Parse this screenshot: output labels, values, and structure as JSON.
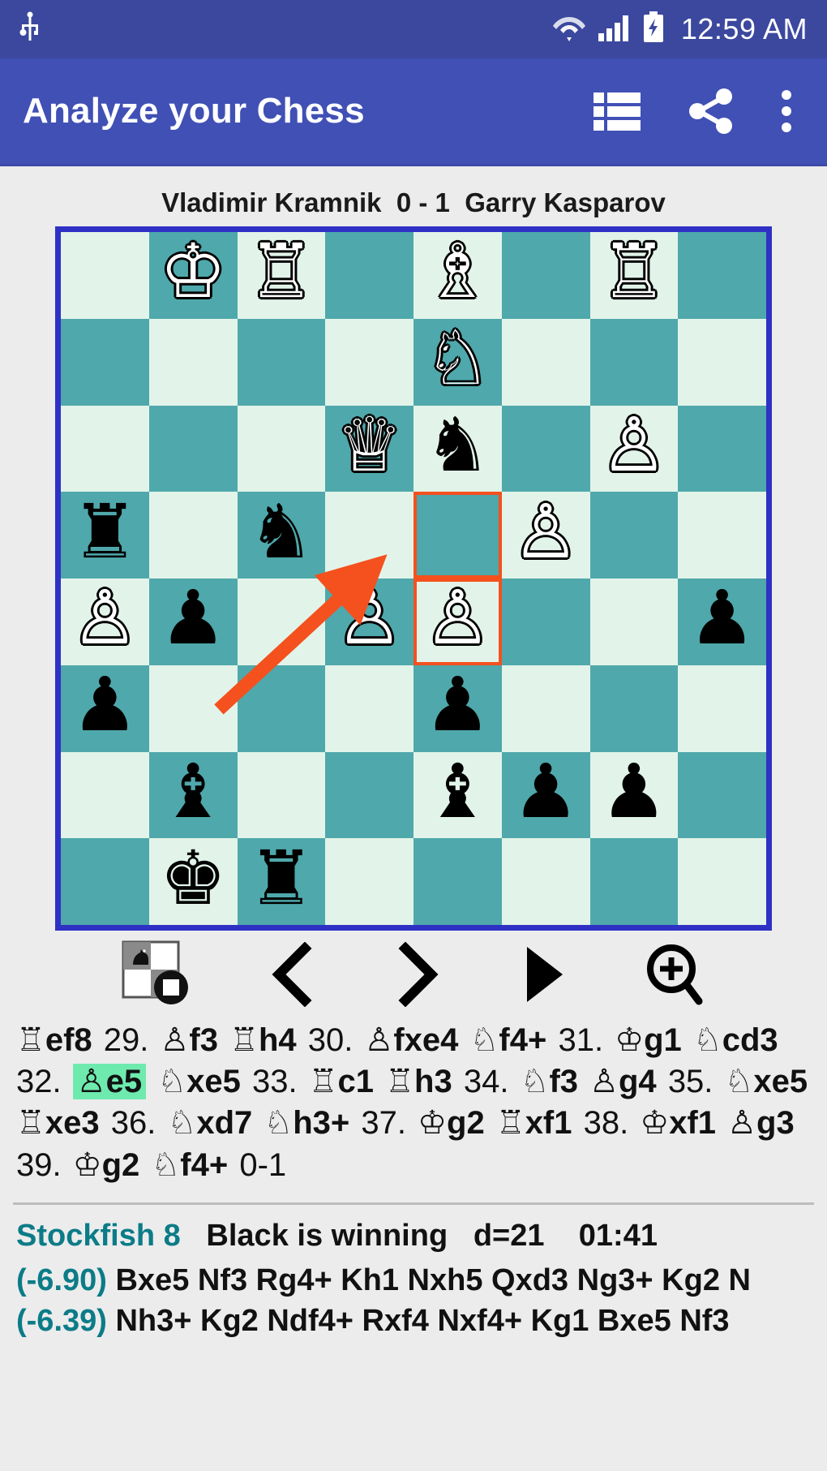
{
  "status_bar": {
    "usb_icon": "usb-icon",
    "wifi_icon": "wifi-icon",
    "signal_icon": "cellular-signal-icon",
    "battery_icon": "battery-charging-icon",
    "time": "12:59 AM"
  },
  "app_bar": {
    "title": "Analyze your Chess",
    "list_icon": "list-view-icon",
    "share_icon": "share-icon",
    "overflow_icon": "overflow-menu-icon",
    "background": "#4050b5"
  },
  "game": {
    "white_player": "Vladimir Kramnik",
    "result": "0 - 1",
    "black_player": "Garry Kasparov",
    "title_line": "Vladimir Kramnik  0 - 1  Garry Kasparov"
  },
  "board": {
    "light_square_color": "#e2f4e9",
    "dark_square_color": "#4fa8ab",
    "border_color": "#2f31c5",
    "highlight_color": "#f4511e",
    "arrow_color": "#f4511e",
    "orientation": "black-at-top-right",
    "highlighted_squares": [
      "e5",
      "e4"
    ],
    "arrow": {
      "from": "b2",
      "to": "e4"
    },
    "rows": [
      [
        null,
        "wK",
        "wR",
        null,
        "wB",
        null,
        "wR",
        null
      ],
      [
        null,
        null,
        null,
        null,
        "wN",
        null,
        null,
        null
      ],
      [
        null,
        null,
        null,
        "wQ",
        "bN",
        null,
        "wP",
        null
      ],
      [
        "bR",
        null,
        "bN",
        null,
        null,
        "wP",
        null,
        null
      ],
      [
        "wP",
        "bP",
        null,
        "wP",
        "wP",
        null,
        null,
        "bP"
      ],
      [
        "bP",
        null,
        null,
        null,
        "bP",
        null,
        null,
        null
      ],
      [
        null,
        "bB",
        null,
        null,
        "bB",
        "bP",
        "bP",
        null
      ],
      [
        null,
        "bK",
        "bR",
        null,
        null,
        null,
        null,
        null
      ]
    ]
  },
  "nav_toolbar": {
    "flip_board_icon": "flip-board-icon",
    "previous_icon": "previous-move-icon",
    "next_icon": "next-move-icon",
    "play_icon": "play-icon",
    "analyze_icon": "zoom-in-magnifier-icon"
  },
  "move_list": {
    "highlight_color": "#6eeaae",
    "current_move": "e5",
    "tokens": [
      {
        "type": "move",
        "piece": "R",
        "text": "ef8"
      },
      {
        "type": "number",
        "text": "29."
      },
      {
        "type": "move",
        "piece": "P",
        "text": "f3"
      },
      {
        "type": "move",
        "piece": "R",
        "text": "h4"
      },
      {
        "type": "number",
        "text": "30."
      },
      {
        "type": "move",
        "piece": "P",
        "text": "fxe4"
      },
      {
        "type": "move",
        "piece": "N",
        "text": "f4+"
      },
      {
        "type": "number",
        "text": "31."
      },
      {
        "type": "move",
        "piece": "K",
        "text": "g1"
      },
      {
        "type": "move",
        "piece": "N",
        "text": "cd3"
      },
      {
        "type": "number",
        "text": "32."
      },
      {
        "type": "move",
        "piece": "P",
        "text": "e5",
        "current": true
      },
      {
        "type": "move",
        "piece": "N",
        "text": "xe5"
      },
      {
        "type": "number",
        "text": "33."
      },
      {
        "type": "move",
        "piece": "R",
        "text": "c1"
      },
      {
        "type": "move",
        "piece": "R",
        "text": "h3"
      },
      {
        "type": "number",
        "text": "34."
      },
      {
        "type": "move",
        "piece": "N",
        "text": "f3"
      },
      {
        "type": "move",
        "piece": "P",
        "text": "g4"
      },
      {
        "type": "number",
        "text": "35."
      },
      {
        "type": "move",
        "piece": "N",
        "text": "xe5"
      },
      {
        "type": "move",
        "piece": "R",
        "text": "xe3"
      },
      {
        "type": "number",
        "text": "36."
      },
      {
        "type": "move",
        "piece": "N",
        "text": "xd7"
      },
      {
        "type": "move",
        "piece": "N",
        "text": "h3+"
      },
      {
        "type": "number",
        "text": "37."
      },
      {
        "type": "move",
        "piece": "K",
        "text": "g2"
      },
      {
        "type": "move",
        "piece": "R",
        "text": "xf1"
      },
      {
        "type": "number",
        "text": "38."
      },
      {
        "type": "move",
        "piece": "K",
        "text": "xf1"
      },
      {
        "type": "move",
        "piece": "P",
        "text": "g3"
      },
      {
        "type": "number",
        "text": "39."
      },
      {
        "type": "move",
        "piece": "K",
        "text": "g2"
      },
      {
        "type": "move",
        "piece": "N",
        "text": "f4+"
      },
      {
        "type": "result",
        "text": "0-1"
      }
    ]
  },
  "engine": {
    "name": "Stockfish 8",
    "name_color": "#0b7c87",
    "evaluation_text": "Black is winning",
    "depth": "d=21",
    "time": "01:41",
    "lines": [
      {
        "score": "(-6.90)",
        "moves": "Bxe5 Nf3 Rg4+ Kh1 Nxh5 Qxd3 Ng3+ Kg2 N"
      },
      {
        "score": "(-6.39)",
        "moves": "Nh3+ Kg2 Ndf4+ Rxf4 Nxf4+ Kg1 Bxe5 Nf3"
      }
    ]
  }
}
